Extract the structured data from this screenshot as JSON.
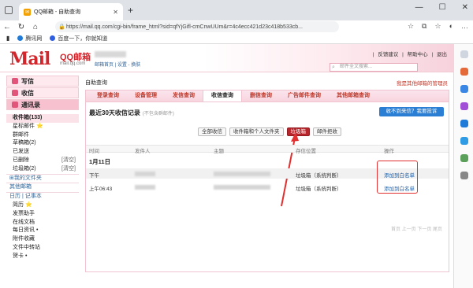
{
  "browser": {
    "tab_title": "QQ邮箱 - 自助查询",
    "new_tab": "+",
    "url": "https://mail.qq.com/cgi-bin/frame_html?sid=qfYjGifl-cmCnwUUm&r=4c4ecc421d23c418b533cb...",
    "window_controls": [
      "—",
      "☐",
      "✕"
    ],
    "bookmarks": [
      {
        "label": "腾讯网",
        "color": "#1f7ad8"
      },
      {
        "label": "百度一下，你就知道",
        "color": "#2f5fe0"
      }
    ]
  },
  "header": {
    "logo_text": "Mail",
    "logo_cn": "QQ邮箱",
    "logo_sub": "mail.qq.com",
    "user_links": "邮箱首页 | 设置 - 换肤",
    "top_links": [
      "|",
      "反馈建议",
      "|",
      "帮助中心",
      "|",
      "退出"
    ],
    "search_placeholder": "邮件全文搜索..."
  },
  "leftnav": {
    "compose": "写信",
    "inbox": "收信",
    "contacts": "通讯录",
    "folders": [
      {
        "label": "收件箱(133)",
        "bold": true,
        "selected": true
      },
      {
        "label": "星标邮件 ⭐"
      },
      {
        "label": "群邮件"
      },
      {
        "label": "草稿箱(2)"
      },
      {
        "label": "已发送"
      },
      {
        "label": "已删除",
        "clear": "[清空]"
      },
      {
        "label": "垃圾箱(2)",
        "clear": "[清空]"
      },
      {
        "label": "⊞我的文件夹",
        "section": true
      },
      {
        "label": "其他邮箱",
        "section": true
      },
      {
        "label": "日历 | 记事本",
        "section": true
      },
      {
        "label": "简历 ⭐"
      },
      {
        "label": "发票助手"
      },
      {
        "label": "在线文档"
      },
      {
        "label": "每日资讯 •"
      },
      {
        "label": "附件收藏"
      },
      {
        "label": "文件中转站"
      },
      {
        "label": "贺卡 •"
      }
    ]
  },
  "main": {
    "breadcrumb": "自助查询",
    "manager_link": "我是其他邮箱的管理员",
    "tabs": [
      "登录查询",
      "设备管理",
      "发信查询",
      "收信查询",
      "删信查询",
      "广告邮件查询",
      "其他邮箱查询"
    ],
    "active_tab": "收信查询",
    "panel_title": "最近30天收信记录",
    "panel_note": "(不包含群邮件)",
    "complain_button": "收不到来信？我要投诉",
    "filters": [
      "全部收信",
      "收件箱和个人文件夹",
      "垃圾箱",
      "邮件拒收"
    ],
    "active_filter": "垃圾箱",
    "columns": [
      "时间",
      "发件人",
      "主题",
      "存信位置",
      "操作"
    ],
    "date_group": "1月11日",
    "rows": [
      {
        "time": "下午",
        "location": "垃圾箱（系统判断）",
        "action": "添加到白名单"
      },
      {
        "time": "上午06:43",
        "location": "垃圾箱（系统判断）",
        "action": "添加到白名单"
      }
    ],
    "pager": "首页 上一页 下一页 尾页"
  },
  "colors": {
    "brand_red": "#d2262d",
    "accent_pink": "#f7c1cf",
    "link_blue": "#1d5fa8",
    "annotation_red": "#e03030"
  }
}
